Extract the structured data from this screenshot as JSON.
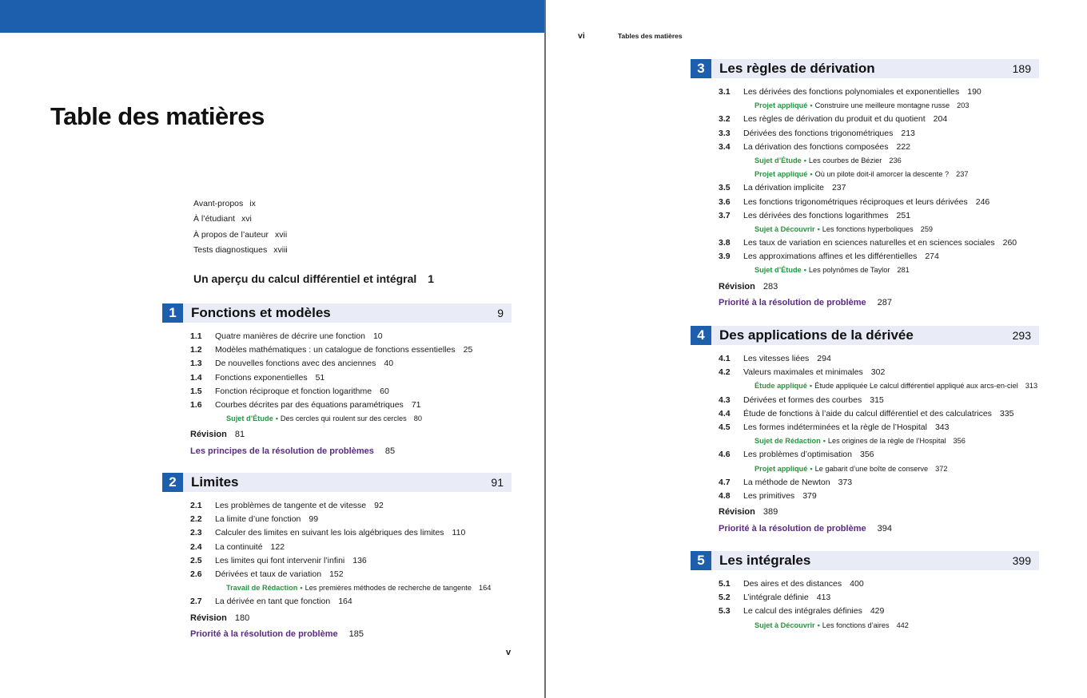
{
  "left_page": {
    "title": "Table des matières",
    "folio": "v",
    "front_matter": [
      {
        "label": "Avant-propos",
        "page": "ix"
      },
      {
        "label": "À l’étudiant",
        "page": "xvi"
      },
      {
        "label": "À propos de l’auteur",
        "page": "xvii"
      },
      {
        "label": "Tests diagnostiques",
        "page": "xviii"
      }
    ],
    "apercu": {
      "label": "Un aperçu du calcul différentiel et intégral",
      "page": "1"
    }
  },
  "right_page": {
    "folio": "vi",
    "running_head": "Tables des matières"
  },
  "colors": {
    "accent": "#1d5fad",
    "chapter_band": "#e9ebf7",
    "project_green": "#2a9340",
    "problem_purple": "#5a2a86"
  },
  "chapters": [
    {
      "number": "1",
      "title": "Fonctions et modèles",
      "page": "9",
      "entries": [
        {
          "type": "section",
          "num": "1.1",
          "text": "Quatre manières de décrire une fonction",
          "page": "10"
        },
        {
          "type": "section",
          "num": "1.2",
          "text": "Modèles mathématiques : un catalogue de fonctions essentielles",
          "page": "25"
        },
        {
          "type": "section",
          "num": "1.3",
          "text": "De nouvelles fonctions avec des anciennes",
          "page": "40"
        },
        {
          "type": "section",
          "num": "1.4",
          "text": "Fonctions exponentielles",
          "page": "51"
        },
        {
          "type": "section",
          "num": "1.5",
          "text": "Fonction réciproque et fonction logarithme",
          "page": "60"
        },
        {
          "type": "section",
          "num": "1.6",
          "text": "Courbes décrites par des équations paramétriques",
          "page": "71"
        },
        {
          "type": "project",
          "kind": "Sujet d’Étude",
          "text": "Des cercles qui roulent sur des cercles",
          "page": "80"
        },
        {
          "type": "revision",
          "label": "Révision",
          "page": "81"
        },
        {
          "type": "problem",
          "label": "Les principes de la résolution de problèmes",
          "page": "85"
        }
      ]
    },
    {
      "number": "2",
      "title": "Limites",
      "page": "91",
      "entries": [
        {
          "type": "section",
          "num": "2.1",
          "text": "Les problèmes de tangente et de vitesse",
          "page": "92"
        },
        {
          "type": "section",
          "num": "2.2",
          "text": "La limite d’une fonction",
          "page": "99"
        },
        {
          "type": "section",
          "num": "2.3",
          "text": "Calculer des limites en suivant les lois algébriques des limites",
          "page": "110"
        },
        {
          "type": "section",
          "num": "2.4",
          "text": "La continuité",
          "page": "122"
        },
        {
          "type": "section",
          "num": "2.5",
          "text": "Les limites qui font intervenir l’infini",
          "page": "136"
        },
        {
          "type": "section",
          "num": "2.6",
          "text": "Dérivées et taux de variation",
          "page": "152"
        },
        {
          "type": "project",
          "kind": "Travail de Rédaction",
          "text": "Les premières méthodes de recherche de tangente",
          "page": "164"
        },
        {
          "type": "section",
          "num": "2.7",
          "text": "La dérivée en tant que fonction",
          "page": "164"
        },
        {
          "type": "revision",
          "label": "Révision",
          "page": "180"
        },
        {
          "type": "problem",
          "label": "Priorité à la résolution de problème",
          "page": "185"
        }
      ]
    },
    {
      "number": "3",
      "title": "Les règles de dérivation",
      "page": "189",
      "entries": [
        {
          "type": "section",
          "num": "3.1",
          "text": "Les dérivées des fonctions polynomiales et exponentielles",
          "page": "190"
        },
        {
          "type": "project",
          "kind": "Projet appliqué",
          "text": "Construire une meilleure montagne russe",
          "page": "203"
        },
        {
          "type": "section",
          "num": "3.2",
          "text": "Les règles de dérivation du produit et du quotient",
          "page": "204"
        },
        {
          "type": "section",
          "num": "3.3",
          "text": "Dérivées des fonctions trigonométriques",
          "page": "213"
        },
        {
          "type": "section",
          "num": "3.4",
          "text": "La dérivation des fonctions composées",
          "page": "222"
        },
        {
          "type": "project",
          "kind": "Sujet d’Étude",
          "text": "Les courbes de Bézier",
          "page": "236"
        },
        {
          "type": "project",
          "kind": "Projet appliqué",
          "text": "Où un pilote doit-il amorcer la descente ?",
          "page": "237"
        },
        {
          "type": "section",
          "num": "3.5",
          "text": "La dérivation implicite",
          "page": "237"
        },
        {
          "type": "section",
          "num": "3.6",
          "text": "Les fonctions trigonométriques réciproques et leurs dérivées",
          "page": "246"
        },
        {
          "type": "section",
          "num": "3.7",
          "text": "Les dérivées des fonctions logarithmes",
          "page": "251"
        },
        {
          "type": "project",
          "kind": "Sujet à Découvrir",
          "text": "Les fonctions hyperboliques",
          "page": "259"
        },
        {
          "type": "section",
          "num": "3.8",
          "text": "Les taux de variation en sciences naturelles et en sciences sociales",
          "page": "260"
        },
        {
          "type": "section",
          "num": "3.9",
          "text": "Les approximations affines et les différentielles",
          "page": "274"
        },
        {
          "type": "project",
          "kind": "Sujet d’Étude",
          "text": "Les polynômes de Taylor",
          "page": "281"
        },
        {
          "type": "revision",
          "label": "Révision",
          "page": "283"
        },
        {
          "type": "problem",
          "label": "Priorité à la résolution de problème",
          "page": "287"
        }
      ]
    },
    {
      "number": "4",
      "title": "Des applications de la dérivée",
      "page": "293",
      "entries": [
        {
          "type": "section",
          "num": "4.1",
          "text": "Les vitesses liées",
          "page": "294"
        },
        {
          "type": "section",
          "num": "4.2",
          "text": "Valeurs maximales et minimales",
          "page": "302"
        },
        {
          "type": "project",
          "kind": "Étude appliqué",
          "text": "Étude appliquée Le calcul différentiel appliqué aux arcs-en-ciel",
          "page": "313"
        },
        {
          "type": "section",
          "num": "4.3",
          "text": "Dérivées et formes des courbes",
          "page": "315"
        },
        {
          "type": "section",
          "num": "4.4",
          "text": "Étude de fonctions à l’aide du calcul différentiel et des calculatrices",
          "page": "335"
        },
        {
          "type": "section",
          "num": "4.5",
          "text": "Les formes indéterminées et la règle de l’Hospital",
          "page": "343"
        },
        {
          "type": "project",
          "kind": "Sujet de Rédaction",
          "text": "Les origines de la règle de l’Hospital",
          "page": "356"
        },
        {
          "type": "section",
          "num": "4.6",
          "text": "Les problèmes d’optimisation",
          "page": "356"
        },
        {
          "type": "project",
          "kind": "Projet appliqué",
          "text": "Le gabarit d’une boîte de conserve",
          "page": "372"
        },
        {
          "type": "section",
          "num": "4.7",
          "text": "La méthode de Newton",
          "page": "373"
        },
        {
          "type": "section",
          "num": "4.8",
          "text": "Les primitives",
          "page": "379"
        },
        {
          "type": "revision",
          "label": "Révision",
          "page": "389"
        },
        {
          "type": "problem",
          "label": "Priorité à la résolution de problème",
          "page": "394"
        }
      ]
    },
    {
      "number": "5",
      "title": "Les intégrales",
      "page": "399",
      "entries": [
        {
          "type": "section",
          "num": "5.1",
          "text": "Des aires et des distances",
          "page": "400"
        },
        {
          "type": "section",
          "num": "5.2",
          "text": "L’intégrale définie",
          "page": "413"
        },
        {
          "type": "section",
          "num": "5.3",
          "text": "Le calcul des intégrales définies",
          "page": "429"
        },
        {
          "type": "project",
          "kind": "Sujet à Découvrir",
          "text": "Les fonctions d’aires",
          "page": "442"
        }
      ]
    }
  ]
}
